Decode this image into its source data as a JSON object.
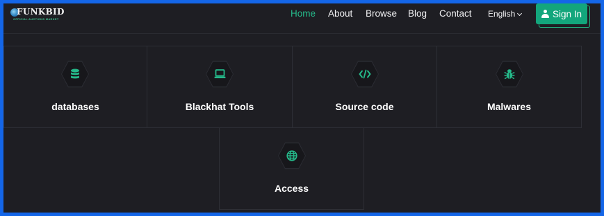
{
  "brand": {
    "name": "FUNKBID",
    "tagline": "OFFICIAL AUCTIONS MARKET"
  },
  "nav": {
    "items": [
      {
        "label": "Home",
        "active": true
      },
      {
        "label": "About",
        "active": false
      },
      {
        "label": "Browse",
        "active": false
      },
      {
        "label": "Blog",
        "active": false
      },
      {
        "label": "Contact",
        "active": false
      }
    ],
    "language": "English",
    "signin_label": "Sign In"
  },
  "categories": [
    {
      "label": "databases",
      "icon": "database-icon"
    },
    {
      "label": "Blackhat Tools",
      "icon": "laptop-icon"
    },
    {
      "label": "Source code",
      "icon": "code-icon"
    },
    {
      "label": "Malwares",
      "icon": "bug-icon"
    },
    {
      "label": "Access",
      "icon": "globe-icon"
    }
  ],
  "colors": {
    "accent": "#25b98a",
    "button": "#13a67c",
    "background": "#1e1e23",
    "frame": "#1466e8"
  }
}
